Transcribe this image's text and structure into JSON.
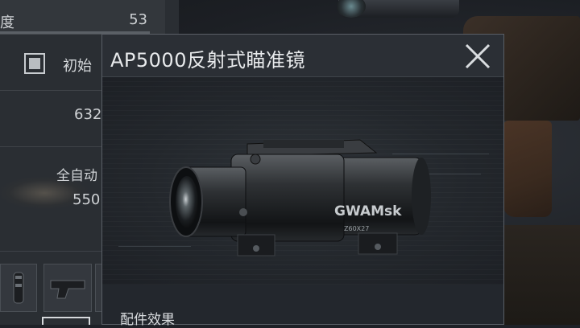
{
  "background_panel": {
    "stat_label": "度",
    "stat_value": "53",
    "checkbox_label": "初始",
    "value_a": "632",
    "fire_mode": "全自动",
    "value_b": "550"
  },
  "modal": {
    "title": "AP5000反射式瞄准镜",
    "section_label": "配件效果",
    "scope_brand": "GWAMsk",
    "scope_model": "Z60X27"
  },
  "colors": {
    "panel_bg": "#23272d",
    "header_bg": "#2b2f35",
    "text": "#e8eaec"
  },
  "icons": {
    "close": "close-icon",
    "checkbox": "checkbox-icon"
  }
}
